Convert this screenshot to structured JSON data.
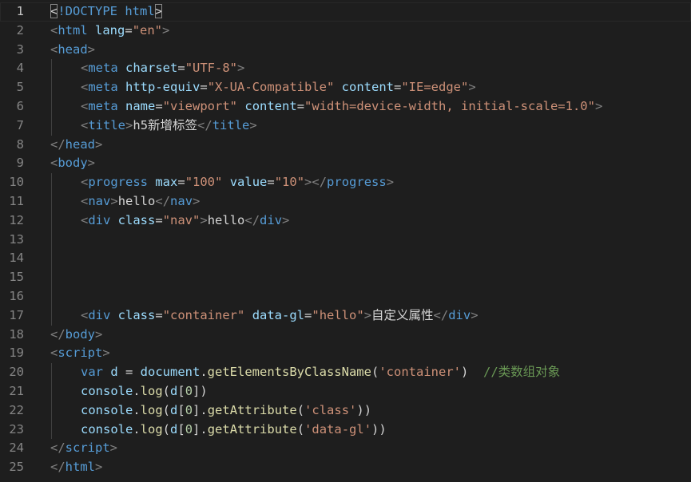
{
  "lines": [
    {
      "n": "1",
      "indent": 0,
      "t": [
        [
          "bm",
          "<"
        ],
        [
          "t-tag",
          "!DOCTYPE html"
        ],
        [
          "bm",
          ">"
        ]
      ]
    },
    {
      "n": "2",
      "indent": 0,
      "t": [
        [
          "t-br",
          "<"
        ],
        [
          "t-tag",
          "html "
        ],
        [
          "t-attr",
          "lang"
        ],
        [
          "t-pun",
          "="
        ],
        [
          "t-str",
          "\"en\""
        ],
        [
          "t-br",
          ">"
        ]
      ]
    },
    {
      "n": "3",
      "indent": 0,
      "t": [
        [
          "t-br",
          "<"
        ],
        [
          "t-tag",
          "head"
        ],
        [
          "t-br",
          ">"
        ]
      ]
    },
    {
      "n": "4",
      "indent": 1,
      "t": [
        [
          "t-br",
          "<"
        ],
        [
          "t-tag",
          "meta "
        ],
        [
          "t-attr",
          "charset"
        ],
        [
          "t-pun",
          "="
        ],
        [
          "t-str",
          "\"UTF-8\""
        ],
        [
          "t-br",
          ">"
        ]
      ]
    },
    {
      "n": "5",
      "indent": 1,
      "t": [
        [
          "t-br",
          "<"
        ],
        [
          "t-tag",
          "meta "
        ],
        [
          "t-attr",
          "http-equiv"
        ],
        [
          "t-pun",
          "="
        ],
        [
          "t-str",
          "\"X-UA-Compatible\""
        ],
        [
          "t-txt",
          " "
        ],
        [
          "t-attr",
          "content"
        ],
        [
          "t-pun",
          "="
        ],
        [
          "t-str",
          "\"IE=edge\""
        ],
        [
          "t-br",
          ">"
        ]
      ]
    },
    {
      "n": "6",
      "indent": 1,
      "t": [
        [
          "t-br",
          "<"
        ],
        [
          "t-tag",
          "meta "
        ],
        [
          "t-attr",
          "name"
        ],
        [
          "t-pun",
          "="
        ],
        [
          "t-str",
          "\"viewport\""
        ],
        [
          "t-txt",
          " "
        ],
        [
          "t-attr",
          "content"
        ],
        [
          "t-pun",
          "="
        ],
        [
          "t-str",
          "\"width=device-width, initial-scale=1.0\""
        ],
        [
          "t-br",
          ">"
        ]
      ]
    },
    {
      "n": "7",
      "indent": 1,
      "t": [
        [
          "t-br",
          "<"
        ],
        [
          "t-tag",
          "title"
        ],
        [
          "t-br",
          ">"
        ],
        [
          "t-txt",
          "h5新增标签"
        ],
        [
          "t-br",
          "</"
        ],
        [
          "t-tag",
          "title"
        ],
        [
          "t-br",
          ">"
        ]
      ]
    },
    {
      "n": "8",
      "indent": 0,
      "t": [
        [
          "t-br",
          "</"
        ],
        [
          "t-tag",
          "head"
        ],
        [
          "t-br",
          ">"
        ]
      ]
    },
    {
      "n": "9",
      "indent": 0,
      "t": [
        [
          "t-br",
          "<"
        ],
        [
          "t-tag",
          "body"
        ],
        [
          "t-br",
          ">"
        ]
      ]
    },
    {
      "n": "10",
      "indent": 1,
      "t": [
        [
          "t-br",
          "<"
        ],
        [
          "t-tag",
          "progress "
        ],
        [
          "t-attr",
          "max"
        ],
        [
          "t-pun",
          "="
        ],
        [
          "t-str",
          "\"100\""
        ],
        [
          "t-txt",
          " "
        ],
        [
          "t-attr",
          "value"
        ],
        [
          "t-pun",
          "="
        ],
        [
          "t-str",
          "\"10\""
        ],
        [
          "t-br",
          "></"
        ],
        [
          "t-tag",
          "progress"
        ],
        [
          "t-br",
          ">"
        ]
      ]
    },
    {
      "n": "11",
      "indent": 1,
      "t": [
        [
          "t-br",
          "<"
        ],
        [
          "t-tag",
          "nav"
        ],
        [
          "t-br",
          ">"
        ],
        [
          "t-txt",
          "hello"
        ],
        [
          "t-br",
          "</"
        ],
        [
          "t-tag",
          "nav"
        ],
        [
          "t-br",
          ">"
        ]
      ]
    },
    {
      "n": "12",
      "indent": 1,
      "t": [
        [
          "t-br",
          "<"
        ],
        [
          "t-tag",
          "div "
        ],
        [
          "t-attr",
          "class"
        ],
        [
          "t-pun",
          "="
        ],
        [
          "t-str",
          "\"nav\""
        ],
        [
          "t-br",
          ">"
        ],
        [
          "t-txt",
          "hello"
        ],
        [
          "t-br",
          "</"
        ],
        [
          "t-tag",
          "div"
        ],
        [
          "t-br",
          ">"
        ]
      ]
    },
    {
      "n": "13",
      "indent": 1,
      "t": []
    },
    {
      "n": "14",
      "indent": 1,
      "t": []
    },
    {
      "n": "15",
      "indent": 1,
      "t": []
    },
    {
      "n": "16",
      "indent": 1,
      "t": []
    },
    {
      "n": "17",
      "indent": 1,
      "t": [
        [
          "t-br",
          "<"
        ],
        [
          "t-tag",
          "div "
        ],
        [
          "t-attr",
          "class"
        ],
        [
          "t-pun",
          "="
        ],
        [
          "t-str",
          "\"container\""
        ],
        [
          "t-txt",
          " "
        ],
        [
          "t-attr",
          "data-gl"
        ],
        [
          "t-pun",
          "="
        ],
        [
          "t-str",
          "\"hello\""
        ],
        [
          "t-br",
          ">"
        ],
        [
          "t-txt",
          "自定义属性"
        ],
        [
          "t-br",
          "</"
        ],
        [
          "t-tag",
          "div"
        ],
        [
          "t-br",
          ">"
        ]
      ]
    },
    {
      "n": "18",
      "indent": 0,
      "t": [
        [
          "t-br",
          "</"
        ],
        [
          "t-tag",
          "body"
        ],
        [
          "t-br",
          ">"
        ]
      ]
    },
    {
      "n": "19",
      "indent": 0,
      "t": [
        [
          "t-br",
          "<"
        ],
        [
          "t-tag",
          "script"
        ],
        [
          "t-br",
          ">"
        ]
      ]
    },
    {
      "n": "20",
      "indent": 1,
      "t": [
        [
          "t-kw",
          "var "
        ],
        [
          "t-var",
          "d"
        ],
        [
          "t-pun",
          " = "
        ],
        [
          "t-var",
          "document"
        ],
        [
          "t-pun",
          "."
        ],
        [
          "t-fn",
          "getElementsByClassName"
        ],
        [
          "t-pun",
          "("
        ],
        [
          "t-str",
          "'container'"
        ],
        [
          "t-pun",
          ")  "
        ],
        [
          "t-cmt",
          "//类数组对象"
        ]
      ]
    },
    {
      "n": "21",
      "indent": 1,
      "t": [
        [
          "t-var",
          "console"
        ],
        [
          "t-pun",
          "."
        ],
        [
          "t-fn",
          "log"
        ],
        [
          "t-pun",
          "("
        ],
        [
          "t-var",
          "d"
        ],
        [
          "t-pun",
          "["
        ],
        [
          "t-num",
          "0"
        ],
        [
          "t-pun",
          "])"
        ]
      ]
    },
    {
      "n": "22",
      "indent": 1,
      "t": [
        [
          "t-var",
          "console"
        ],
        [
          "t-pun",
          "."
        ],
        [
          "t-fn",
          "log"
        ],
        [
          "t-pun",
          "("
        ],
        [
          "t-var",
          "d"
        ],
        [
          "t-pun",
          "["
        ],
        [
          "t-num",
          "0"
        ],
        [
          "t-pun",
          "]."
        ],
        [
          "t-fn",
          "getAttribute"
        ],
        [
          "t-pun",
          "("
        ],
        [
          "t-str",
          "'class'"
        ],
        [
          "t-pun",
          "))"
        ]
      ]
    },
    {
      "n": "23",
      "indent": 1,
      "t": [
        [
          "t-var",
          "console"
        ],
        [
          "t-pun",
          "."
        ],
        [
          "t-fn",
          "log"
        ],
        [
          "t-pun",
          "("
        ],
        [
          "t-var",
          "d"
        ],
        [
          "t-pun",
          "["
        ],
        [
          "t-num",
          "0"
        ],
        [
          "t-pun",
          "]."
        ],
        [
          "t-fn",
          "getAttribute"
        ],
        [
          "t-pun",
          "("
        ],
        [
          "t-str",
          "'data-gl'"
        ],
        [
          "t-pun",
          "))"
        ]
      ]
    },
    {
      "n": "24",
      "indent": 0,
      "t": [
        [
          "t-br",
          "</"
        ],
        [
          "t-tag",
          "script"
        ],
        [
          "t-br",
          ">"
        ]
      ]
    },
    {
      "n": "25",
      "indent": 0,
      "t": [
        [
          "t-br",
          "</"
        ],
        [
          "t-tag",
          "html"
        ],
        [
          "t-br",
          ">"
        ]
      ]
    }
  ],
  "current_line": "1",
  "colors": {
    "background": "#1e1e1e",
    "line_number": "#858585",
    "tag": "#569cd6",
    "attribute": "#9cdcfe",
    "string": "#ce9178",
    "function": "#dcdcaa",
    "comment": "#6a9955",
    "number": "#b5cea8"
  }
}
